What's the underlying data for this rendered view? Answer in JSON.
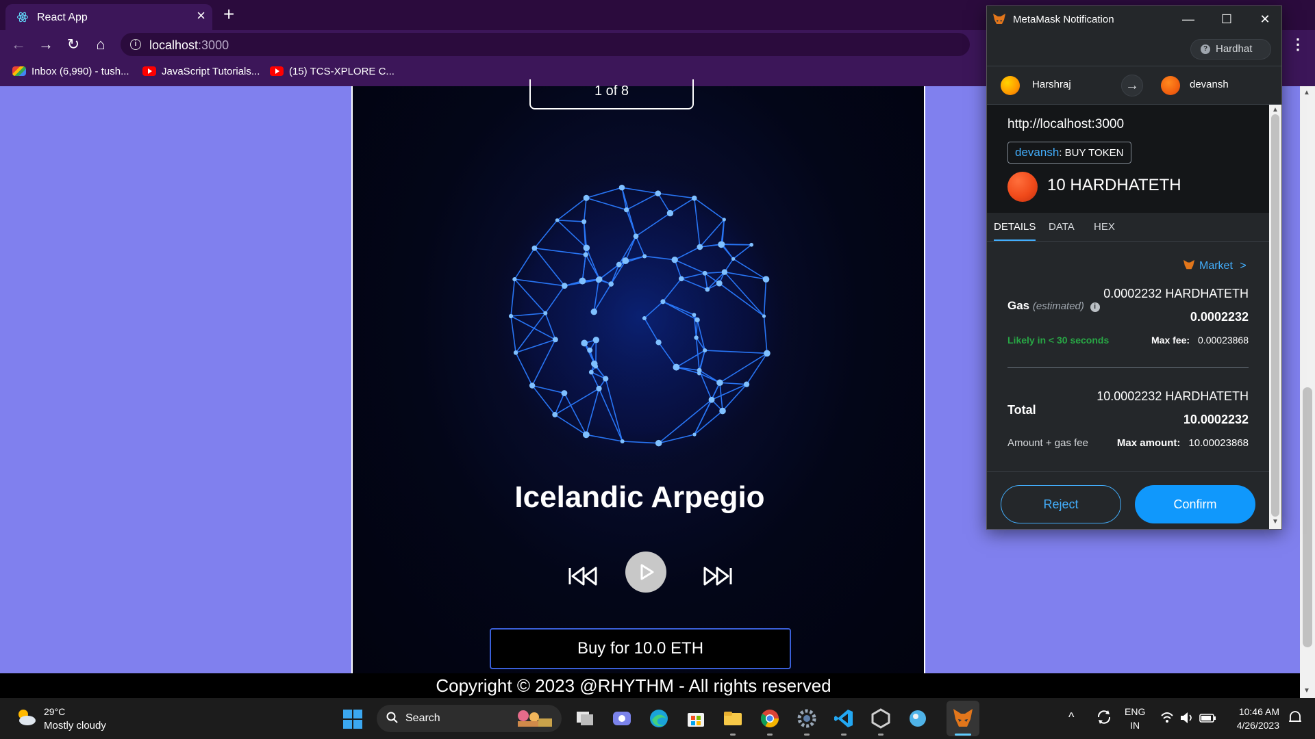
{
  "browser": {
    "tab_title": "React App",
    "new_tab_symbol": "+",
    "url_host": "localhost",
    "url_port": ":3000",
    "bookmarks": [
      {
        "label": "Inbox (6,990) - tush...",
        "icon": "gmail-icon"
      },
      {
        "label": "JavaScript Tutorials...",
        "icon": "youtube-icon"
      },
      {
        "label": "(15) TCS-XPLORE C...",
        "icon": "youtube-icon"
      }
    ]
  },
  "player": {
    "counter": "1 of 8",
    "song_title": "Icelandic Arpegio",
    "buy_label": "Buy for 10.0 ETH",
    "colors": {
      "panel": "#030618",
      "accent": "#1a6bff"
    }
  },
  "footer": {
    "copyright": "Copyright © 2023 @RHYTHM - All rights reserved"
  },
  "metamask": {
    "window_title": "MetaMask Notification",
    "network": "Hardhat",
    "from_account": "Harshraj",
    "to_account": "devansh",
    "origin": "http://localhost:3000",
    "method_to": "devansh",
    "method_name": ": BUY TOKEN",
    "amount": "10 HARDHATETH",
    "tabs": [
      "DETAILS",
      "DATA",
      "HEX"
    ],
    "market_label": "Market",
    "market_chevron": ">",
    "gas": {
      "label": "Gas",
      "estimated": "(estimated)",
      "sub_value": "0.0002232 HARDHATETH",
      "main_value": "0.0002232",
      "likely": "Likely in < 30 seconds",
      "max_fee_label": "Max fee:",
      "max_fee_value": "0.00023868"
    },
    "total": {
      "label": "Total",
      "sub_value": "10.0002232 HARDHATETH",
      "main_value": "10.0002232",
      "amount_gas_fee": "Amount + gas fee",
      "max_amount_label": "Max amount:",
      "max_amount_value": "10.00023868"
    },
    "reject_label": "Reject",
    "confirm_label": "Confirm",
    "colors": {
      "primary": "#1098fc",
      "link": "#43aefc",
      "success": "#28a745"
    }
  },
  "taskbar": {
    "weather_temp": "29°C",
    "weather_desc": "Mostly cloudy",
    "search_label": "Search",
    "lang_line1": "ENG",
    "lang_line2": "IN",
    "time": "10:46 AM",
    "date": "4/26/2023",
    "apps": [
      "file-explorer-icon",
      "teams-icon",
      "edge-icon",
      "store-icon",
      "folder-icon",
      "chrome-icon",
      "settings-icon",
      "vscode-icon",
      "unity-icon",
      "app-icon",
      "metamask-icon"
    ]
  }
}
